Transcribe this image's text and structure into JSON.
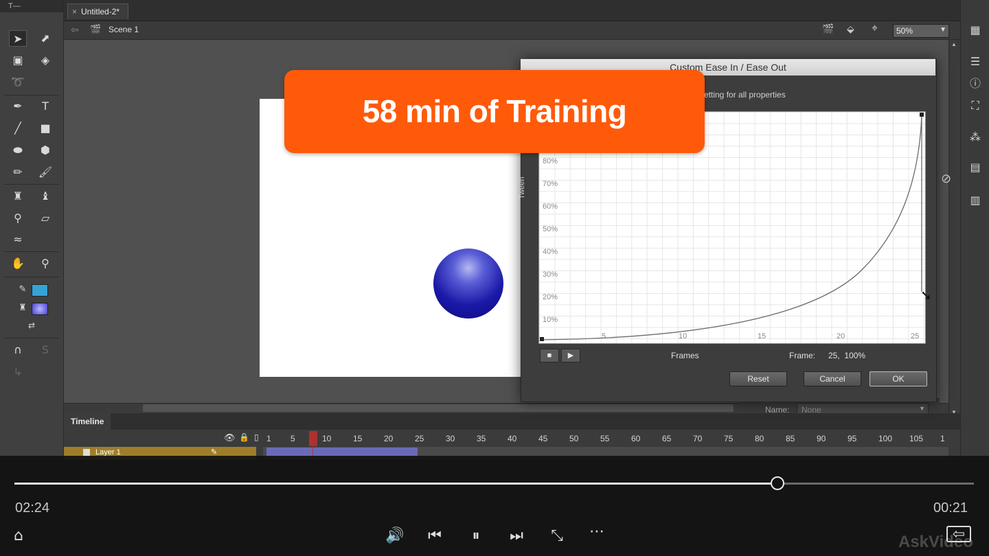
{
  "app": {
    "document_tab": "Untitled-2*",
    "scene_label": "Scene 1",
    "zoom": "50%",
    "toolbar_header": "T—",
    "timeline_tab": "Timeline",
    "layer_name": "Layer 1",
    "frame_numbers": [
      "1",
      "5",
      "10",
      "15",
      "20",
      "25",
      "30",
      "35",
      "40",
      "45",
      "50",
      "55",
      "60",
      "65",
      "70",
      "75",
      "80",
      "85",
      "90",
      "95",
      "100",
      "105",
      "1"
    ],
    "properties": {
      "name_label": "Name:",
      "name_value": "None"
    }
  },
  "dialog": {
    "title": "Custom Ease In / Ease Out",
    "setting_text": "etting for all properties",
    "y_axis_label": "Tween",
    "y_ticks": [
      "80%",
      "70%",
      "60%",
      "50%",
      "40%",
      "30%",
      "20%",
      "10%"
    ],
    "x_ticks": [
      "5",
      "10",
      "15",
      "20",
      "25"
    ],
    "x_axis_label": "Frames",
    "frame_readout_label": "Frame:",
    "frame_readout_value": "25,  100%",
    "stop_icon": "■",
    "play_icon": "▶",
    "buttons": {
      "reset": "Reset",
      "cancel": "Cancel",
      "ok": "OK"
    }
  },
  "promo": {
    "text": "58 min of Training"
  },
  "player": {
    "elapsed": "02:24",
    "remaining": "00:21",
    "progress": 0.795,
    "watermark": "AskVideo",
    "icons": {
      "home": "⌂",
      "volume": "🔊",
      "prev": "⏮",
      "pause": "⏸",
      "next": "⏭",
      "fullscreen": "⤡",
      "more": "⋯",
      "exit": "⇦"
    }
  }
}
